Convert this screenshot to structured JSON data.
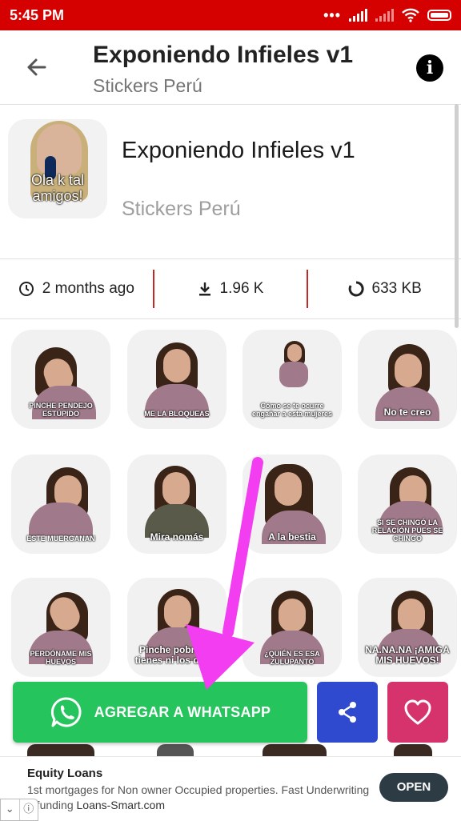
{
  "status_bar": {
    "time": "5:45 PM"
  },
  "app_bar": {
    "title": "Exponiendo Infieles v1",
    "subtitle": "Stickers Perú"
  },
  "pack": {
    "title": "Exponiendo Infieles v1",
    "publisher": "Stickers Perú",
    "tray_caption": "Ola k tal amigos!"
  },
  "stats": {
    "updated": "2 months ago",
    "downloads": "1.96 K",
    "size": "633 KB"
  },
  "stickers": [
    {
      "caption": "PINCHE PENDEJO ESTÚPIDO"
    },
    {
      "caption": "ME LA BLOQUEAS"
    },
    {
      "caption": "Cómo se te ocurre engañar a esta mujeres"
    },
    {
      "caption": "No te creo"
    },
    {
      "caption": "ESTE MUERGANAN"
    },
    {
      "caption": "Mira nomás"
    },
    {
      "caption": "A la bestia"
    },
    {
      "caption": "SI SE CHINGÓ LA RELACIÓN PUES SE CHINGÓ"
    },
    {
      "caption": "PERDÓNAME MIS HUEVOS"
    },
    {
      "caption": "Pinche pobre no tienes ni los datos"
    },
    {
      "caption": "¿QUIÉN ES ESA ZULUPANTO"
    },
    {
      "caption": "NA.NA.NA ¡AMIGA MIS HUEVOS!"
    }
  ],
  "actions": {
    "add_label": "AGREGAR A WHATSAPP"
  },
  "ad": {
    "title": "Equity Loans",
    "text": "1st mortgages for Non owner Occupied properties. Fast Underwriting",
    "text2": "d funding",
    "domain": "Loans-Smart.com",
    "cta": "OPEN"
  },
  "colors": {
    "status_bar": "#d50000",
    "whatsapp_green": "#25c45d",
    "share_blue": "#2f49cf",
    "favorite_pink": "#d6336c",
    "annotation_arrow": "#f23ef0"
  }
}
